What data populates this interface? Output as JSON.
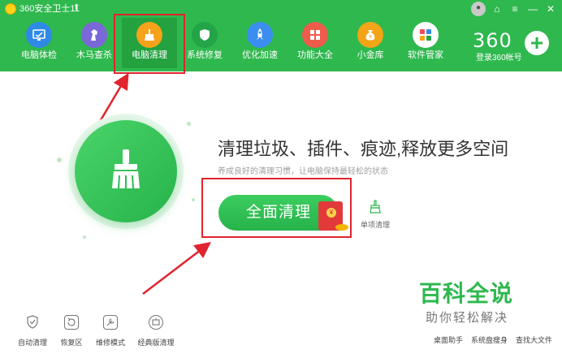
{
  "app": {
    "title": "360安全卫士11"
  },
  "nav": {
    "items": [
      {
        "label": "电脑体检",
        "icon": "monitor-check-icon",
        "color": "#2f8ae6"
      },
      {
        "label": "木马查杀",
        "icon": "horse-icon",
        "color": "#7b68d8"
      },
      {
        "label": "电脑清理",
        "icon": "broom-icon",
        "color": "#f7a21b",
        "active": true
      },
      {
        "label": "系统修复",
        "icon": "shield-icon",
        "color": "#22a447"
      },
      {
        "label": "优化加速",
        "icon": "rocket-icon",
        "color": "#3b8ef0"
      },
      {
        "label": "功能大全",
        "icon": "grid-icon",
        "color": "#ef5c4c"
      },
      {
        "label": "小金库",
        "icon": "money-bag-icon",
        "color": "#f3a417"
      },
      {
        "label": "软件管家",
        "icon": "apps-icon",
        "color": "#ffffff"
      }
    ]
  },
  "brand": {
    "logo_text": "360",
    "login_label": "登录360帐号"
  },
  "main": {
    "headline": "清理垃圾、插件、痕迹,释放更多空间",
    "subtext": "养成良好的清理习惯，让电脑保持最轻松的状态",
    "clean_button_label": "全面清理",
    "single_clean_label": "单项清理"
  },
  "bottom_tools": [
    {
      "label": "自动清理",
      "icon": "shield-check-icon"
    },
    {
      "label": "恢复区",
      "icon": "restore-icon"
    },
    {
      "label": "维修模式",
      "icon": "wrench-icon"
    },
    {
      "label": "经典版清理",
      "icon": "classic-icon"
    }
  ],
  "bottom_right": [
    {
      "label": "桌面助手"
    },
    {
      "label": "系统盘瘦身"
    },
    {
      "label": "查找大文件"
    }
  ],
  "watermark": {
    "title": "百科全说",
    "subtitle": "助你轻松解决"
  },
  "colors": {
    "brand_green": "#2fb84e",
    "highlight_red": "#e0242d"
  }
}
